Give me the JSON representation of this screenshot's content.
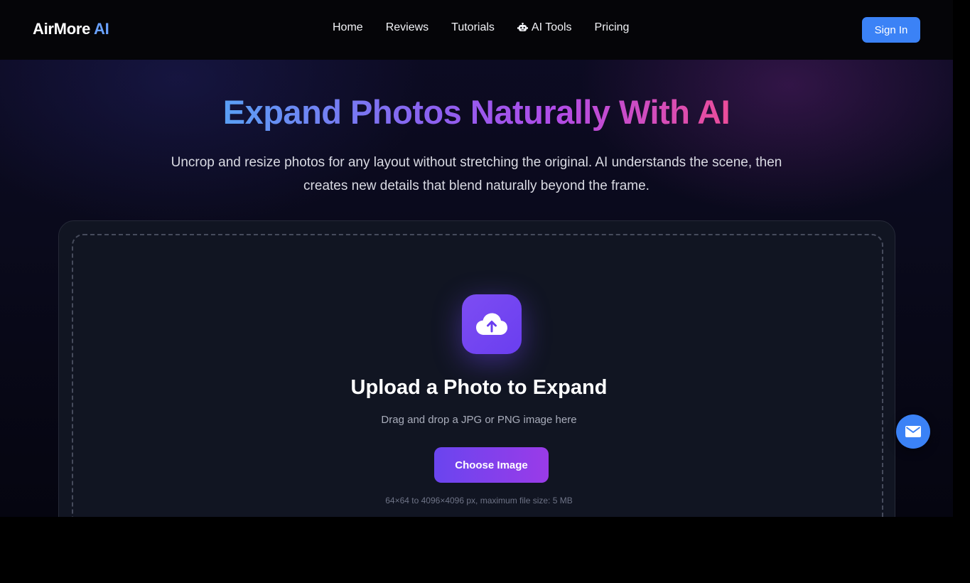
{
  "header": {
    "logo_main": "AirMore",
    "logo_accent": "AI",
    "nav": [
      {
        "label": "Home"
      },
      {
        "label": "Reviews"
      },
      {
        "label": "Tutorials"
      },
      {
        "label": "AI Tools",
        "icon": "robot-icon"
      },
      {
        "label": "Pricing"
      }
    ],
    "signin_label": "Sign In"
  },
  "hero": {
    "title": "Expand Photos Naturally With AI",
    "subtitle": "Uncrop and resize photos for any layout without stretching the original. AI understands the scene, then creates new details that blend naturally beyond the frame."
  },
  "upload": {
    "icon": "cloud-upload-icon",
    "title": "Upload a Photo to Expand",
    "hint": "Drag and drop a JPG or PNG image here",
    "button_label": "Choose Image",
    "limits": "64×64 to 4096×4096 px, maximum file size: 5 MB"
  },
  "fab": {
    "icon": "mail-icon"
  },
  "colors": {
    "accent_blue": "#3b82f6",
    "purple": "#6a45ef",
    "pink": "#ec4d9a"
  }
}
